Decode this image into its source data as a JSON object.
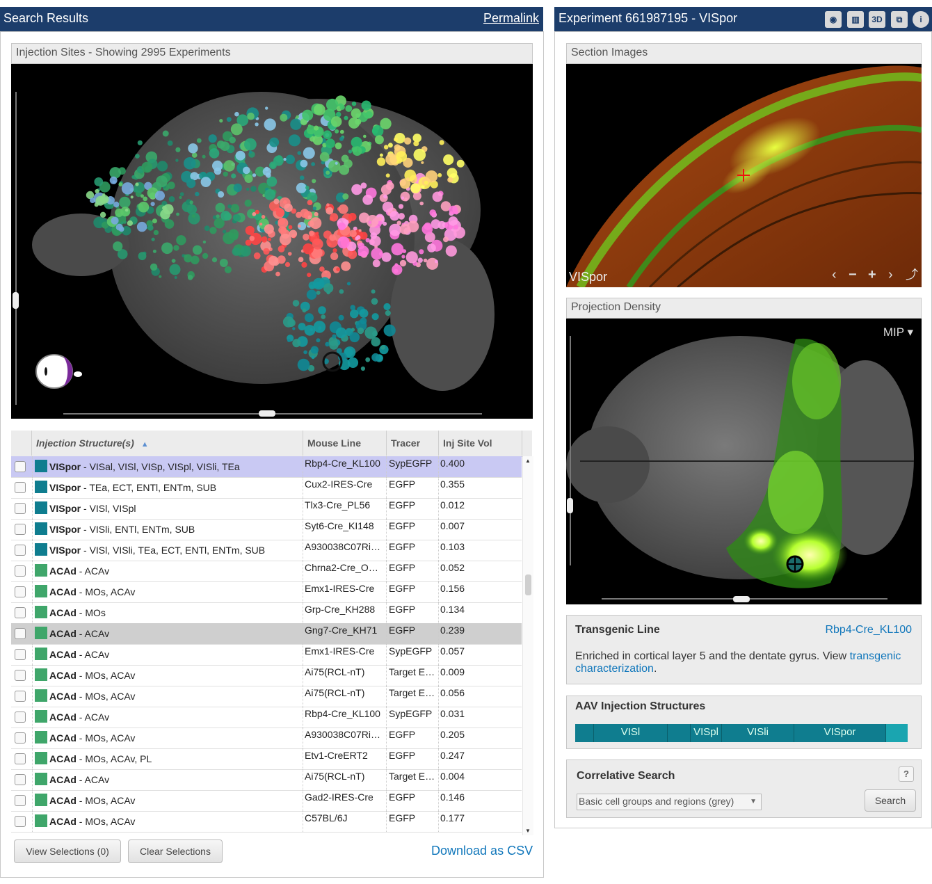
{
  "left": {
    "title": "Search Results",
    "permalink": "Permalink",
    "injection_sites_label": "Injection Sites - Showing 2995 Experiments"
  },
  "grid": {
    "headers": [
      "Injection Structure(s)",
      "Mouse Line",
      "Tracer",
      "Inj Site Vol"
    ],
    "rows": [
      {
        "primary": "VISpor",
        "rest": " - VISal, VISl, VISp, VISpl, VISli, TEa",
        "line": "Rbp4-Cre_KL100",
        "tracer": "SypEGFP",
        "vol": "0.400",
        "color": "#0f7d8f",
        "state": "selected"
      },
      {
        "primary": "VISpor",
        "rest": " - TEa, ECT, ENTl, ENTm, SUB",
        "line": "Cux2-IRES-Cre",
        "tracer": "EGFP",
        "vol": "0.355",
        "color": "#0f7d8f",
        "state": ""
      },
      {
        "primary": "VISpor",
        "rest": " - VISl, VISpl",
        "line": "Tlx3-Cre_PL56",
        "tracer": "EGFP",
        "vol": "0.012",
        "color": "#0f7d8f",
        "state": ""
      },
      {
        "primary": "VISpor",
        "rest": " - VISli, ENTl, ENTm, SUB",
        "line": "Syt6-Cre_KI148",
        "tracer": "EGFP",
        "vol": "0.007",
        "color": "#0f7d8f",
        "state": ""
      },
      {
        "primary": "VISpor",
        "rest": " - VISl, VISli, TEa, ECT, ENTl, ENTm, SUB",
        "line": "A930038C07Ri…",
        "tracer": "EGFP",
        "vol": "0.103",
        "color": "#0f7d8f",
        "state": ""
      },
      {
        "primary": "ACAd",
        "rest": " - ACAv",
        "line": "Chrna2-Cre_O…",
        "tracer": "EGFP",
        "vol": "0.052",
        "color": "#3fa66a",
        "state": ""
      },
      {
        "primary": "ACAd",
        "rest": " - MOs, ACAv",
        "line": "Emx1-IRES-Cre",
        "tracer": "EGFP",
        "vol": "0.156",
        "color": "#3fa66a",
        "state": ""
      },
      {
        "primary": "ACAd",
        "rest": " - MOs",
        "line": "Grp-Cre_KH288",
        "tracer": "EGFP",
        "vol": "0.134",
        "color": "#3fa66a",
        "state": ""
      },
      {
        "primary": "ACAd",
        "rest": " - ACAv",
        "line": "Gng7-Cre_KH71",
        "tracer": "EGFP",
        "vol": "0.239",
        "color": "#3fa66a",
        "state": "hover"
      },
      {
        "primary": "ACAd",
        "rest": " - ACAv",
        "line": "Emx1-IRES-Cre",
        "tracer": "SypEGFP",
        "vol": "0.057",
        "color": "#3fa66a",
        "state": ""
      },
      {
        "primary": "ACAd",
        "rest": " - MOs, ACAv",
        "line": "Ai75(RCL-nT)",
        "tracer": "Target E…",
        "vol": "0.009",
        "color": "#3fa66a",
        "state": ""
      },
      {
        "primary": "ACAd",
        "rest": " - MOs, ACAv",
        "line": "Ai75(RCL-nT)",
        "tracer": "Target E…",
        "vol": "0.056",
        "color": "#3fa66a",
        "state": ""
      },
      {
        "primary": "ACAd",
        "rest": " - ACAv",
        "line": "Rbp4-Cre_KL100",
        "tracer": "SypEGFP",
        "vol": "0.031",
        "color": "#3fa66a",
        "state": ""
      },
      {
        "primary": "ACAd",
        "rest": " - MOs, ACAv",
        "line": "A930038C07Ri…",
        "tracer": "EGFP",
        "vol": "0.205",
        "color": "#3fa66a",
        "state": ""
      },
      {
        "primary": "ACAd",
        "rest": " - MOs, ACAv, PL",
        "line": "Etv1-CreERT2",
        "tracer": "EGFP",
        "vol": "0.247",
        "color": "#3fa66a",
        "state": ""
      },
      {
        "primary": "ACAd",
        "rest": " - ACAv",
        "line": "Ai75(RCL-nT)",
        "tracer": "Target E…",
        "vol": "0.004",
        "color": "#3fa66a",
        "state": ""
      },
      {
        "primary": "ACAd",
        "rest": " - MOs, ACAv",
        "line": "Gad2-IRES-Cre",
        "tracer": "EGFP",
        "vol": "0.146",
        "color": "#3fa66a",
        "state": ""
      },
      {
        "primary": "ACAd",
        "rest": " - MOs, ACAv",
        "line": "C57BL/6J",
        "tracer": "EGFP",
        "vol": "0.177",
        "color": "#3fa66a",
        "state": ""
      }
    ]
  },
  "buttons": {
    "view_selections": "View Selections (0)",
    "clear_selections": "Clear Selections",
    "download_csv": "Download as CSV"
  },
  "right": {
    "title": "Experiment 661987195 - VISpor",
    "header_icons": [
      "brain-icon",
      "layout-icon",
      "3d-icon",
      "popout-icon",
      "info-icon"
    ],
    "icon_labels": [
      "3D"
    ],
    "section_images_label": "Section Images",
    "section_structure": "VISpor",
    "projection_density_label": "Projection Density",
    "mip_label": "MIP ▾",
    "transgenic": {
      "title": "Transgenic Line",
      "line": "Rbp4-Cre_KL100",
      "desc": "Enriched in cortical layer 5 and the dentate gyrus. View ",
      "link": "transgenic characterization",
      "period": "."
    },
    "aav": {
      "title": "AAV Injection Structures",
      "segments": [
        "VISl",
        "VISpl",
        "VISli",
        "VISpor"
      ]
    },
    "correlative": {
      "title": "Correlative Search",
      "help": "?",
      "select_value": "Basic cell groups and regions (grey)",
      "search_button": "Search"
    }
  },
  "colors": {
    "header_bg": "#1c3d6b",
    "link": "#1177bb",
    "vispor": "#0f7d8f",
    "acad": "#3fa66a",
    "selected_row": "#c9c9f3",
    "hover_row": "#cfcfcf"
  }
}
